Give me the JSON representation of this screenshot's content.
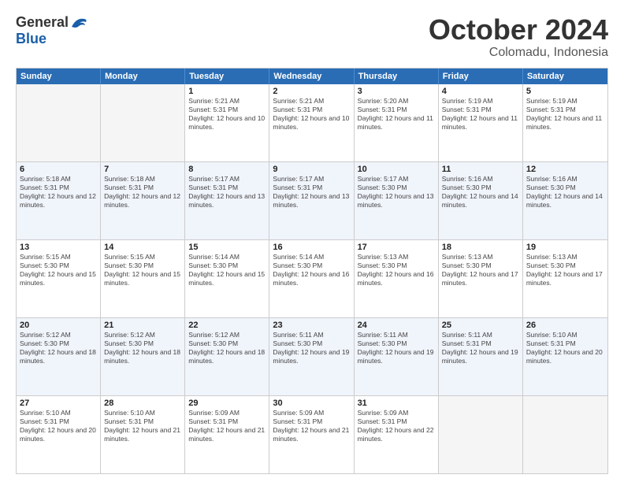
{
  "logo": {
    "general": "General",
    "blue": "Blue"
  },
  "title": "October 2024",
  "location": "Colomadu, Indonesia",
  "days": [
    "Sunday",
    "Monday",
    "Tuesday",
    "Wednesday",
    "Thursday",
    "Friday",
    "Saturday"
  ],
  "rows": [
    [
      {
        "date": "",
        "sunrise": "",
        "sunset": "",
        "daylight": "",
        "empty": true
      },
      {
        "date": "",
        "sunrise": "",
        "sunset": "",
        "daylight": "",
        "empty": true
      },
      {
        "date": "1",
        "sunrise": "Sunrise: 5:21 AM",
        "sunset": "Sunset: 5:31 PM",
        "daylight": "Daylight: 12 hours and 10 minutes.",
        "empty": false
      },
      {
        "date": "2",
        "sunrise": "Sunrise: 5:21 AM",
        "sunset": "Sunset: 5:31 PM",
        "daylight": "Daylight: 12 hours and 10 minutes.",
        "empty": false
      },
      {
        "date": "3",
        "sunrise": "Sunrise: 5:20 AM",
        "sunset": "Sunset: 5:31 PM",
        "daylight": "Daylight: 12 hours and 11 minutes.",
        "empty": false
      },
      {
        "date": "4",
        "sunrise": "Sunrise: 5:19 AM",
        "sunset": "Sunset: 5:31 PM",
        "daylight": "Daylight: 12 hours and 11 minutes.",
        "empty": false
      },
      {
        "date": "5",
        "sunrise": "Sunrise: 5:19 AM",
        "sunset": "Sunset: 5:31 PM",
        "daylight": "Daylight: 12 hours and 11 minutes.",
        "empty": false
      }
    ],
    [
      {
        "date": "6",
        "sunrise": "Sunrise: 5:18 AM",
        "sunset": "Sunset: 5:31 PM",
        "daylight": "Daylight: 12 hours and 12 minutes.",
        "empty": false
      },
      {
        "date": "7",
        "sunrise": "Sunrise: 5:18 AM",
        "sunset": "Sunset: 5:31 PM",
        "daylight": "Daylight: 12 hours and 12 minutes.",
        "empty": false
      },
      {
        "date": "8",
        "sunrise": "Sunrise: 5:17 AM",
        "sunset": "Sunset: 5:31 PM",
        "daylight": "Daylight: 12 hours and 13 minutes.",
        "empty": false
      },
      {
        "date": "9",
        "sunrise": "Sunrise: 5:17 AM",
        "sunset": "Sunset: 5:31 PM",
        "daylight": "Daylight: 12 hours and 13 minutes.",
        "empty": false
      },
      {
        "date": "10",
        "sunrise": "Sunrise: 5:17 AM",
        "sunset": "Sunset: 5:30 PM",
        "daylight": "Daylight: 12 hours and 13 minutes.",
        "empty": false
      },
      {
        "date": "11",
        "sunrise": "Sunrise: 5:16 AM",
        "sunset": "Sunset: 5:30 PM",
        "daylight": "Daylight: 12 hours and 14 minutes.",
        "empty": false
      },
      {
        "date": "12",
        "sunrise": "Sunrise: 5:16 AM",
        "sunset": "Sunset: 5:30 PM",
        "daylight": "Daylight: 12 hours and 14 minutes.",
        "empty": false
      }
    ],
    [
      {
        "date": "13",
        "sunrise": "Sunrise: 5:15 AM",
        "sunset": "Sunset: 5:30 PM",
        "daylight": "Daylight: 12 hours and 15 minutes.",
        "empty": false
      },
      {
        "date": "14",
        "sunrise": "Sunrise: 5:15 AM",
        "sunset": "Sunset: 5:30 PM",
        "daylight": "Daylight: 12 hours and 15 minutes.",
        "empty": false
      },
      {
        "date": "15",
        "sunrise": "Sunrise: 5:14 AM",
        "sunset": "Sunset: 5:30 PM",
        "daylight": "Daylight: 12 hours and 15 minutes.",
        "empty": false
      },
      {
        "date": "16",
        "sunrise": "Sunrise: 5:14 AM",
        "sunset": "Sunset: 5:30 PM",
        "daylight": "Daylight: 12 hours and 16 minutes.",
        "empty": false
      },
      {
        "date": "17",
        "sunrise": "Sunrise: 5:13 AM",
        "sunset": "Sunset: 5:30 PM",
        "daylight": "Daylight: 12 hours and 16 minutes.",
        "empty": false
      },
      {
        "date": "18",
        "sunrise": "Sunrise: 5:13 AM",
        "sunset": "Sunset: 5:30 PM",
        "daylight": "Daylight: 12 hours and 17 minutes.",
        "empty": false
      },
      {
        "date": "19",
        "sunrise": "Sunrise: 5:13 AM",
        "sunset": "Sunset: 5:30 PM",
        "daylight": "Daylight: 12 hours and 17 minutes.",
        "empty": false
      }
    ],
    [
      {
        "date": "20",
        "sunrise": "Sunrise: 5:12 AM",
        "sunset": "Sunset: 5:30 PM",
        "daylight": "Daylight: 12 hours and 18 minutes.",
        "empty": false
      },
      {
        "date": "21",
        "sunrise": "Sunrise: 5:12 AM",
        "sunset": "Sunset: 5:30 PM",
        "daylight": "Daylight: 12 hours and 18 minutes.",
        "empty": false
      },
      {
        "date": "22",
        "sunrise": "Sunrise: 5:12 AM",
        "sunset": "Sunset: 5:30 PM",
        "daylight": "Daylight: 12 hours and 18 minutes.",
        "empty": false
      },
      {
        "date": "23",
        "sunrise": "Sunrise: 5:11 AM",
        "sunset": "Sunset: 5:30 PM",
        "daylight": "Daylight: 12 hours and 19 minutes.",
        "empty": false
      },
      {
        "date": "24",
        "sunrise": "Sunrise: 5:11 AM",
        "sunset": "Sunset: 5:30 PM",
        "daylight": "Daylight: 12 hours and 19 minutes.",
        "empty": false
      },
      {
        "date": "25",
        "sunrise": "Sunrise: 5:11 AM",
        "sunset": "Sunset: 5:31 PM",
        "daylight": "Daylight: 12 hours and 19 minutes.",
        "empty": false
      },
      {
        "date": "26",
        "sunrise": "Sunrise: 5:10 AM",
        "sunset": "Sunset: 5:31 PM",
        "daylight": "Daylight: 12 hours and 20 minutes.",
        "empty": false
      }
    ],
    [
      {
        "date": "27",
        "sunrise": "Sunrise: 5:10 AM",
        "sunset": "Sunset: 5:31 PM",
        "daylight": "Daylight: 12 hours and 20 minutes.",
        "empty": false
      },
      {
        "date": "28",
        "sunrise": "Sunrise: 5:10 AM",
        "sunset": "Sunset: 5:31 PM",
        "daylight": "Daylight: 12 hours and 21 minutes.",
        "empty": false
      },
      {
        "date": "29",
        "sunrise": "Sunrise: 5:09 AM",
        "sunset": "Sunset: 5:31 PM",
        "daylight": "Daylight: 12 hours and 21 minutes.",
        "empty": false
      },
      {
        "date": "30",
        "sunrise": "Sunrise: 5:09 AM",
        "sunset": "Sunset: 5:31 PM",
        "daylight": "Daylight: 12 hours and 21 minutes.",
        "empty": false
      },
      {
        "date": "31",
        "sunrise": "Sunrise: 5:09 AM",
        "sunset": "Sunset: 5:31 PM",
        "daylight": "Daylight: 12 hours and 22 minutes.",
        "empty": false
      },
      {
        "date": "",
        "sunrise": "",
        "sunset": "",
        "daylight": "",
        "empty": true
      },
      {
        "date": "",
        "sunrise": "",
        "sunset": "",
        "daylight": "",
        "empty": true
      }
    ]
  ]
}
